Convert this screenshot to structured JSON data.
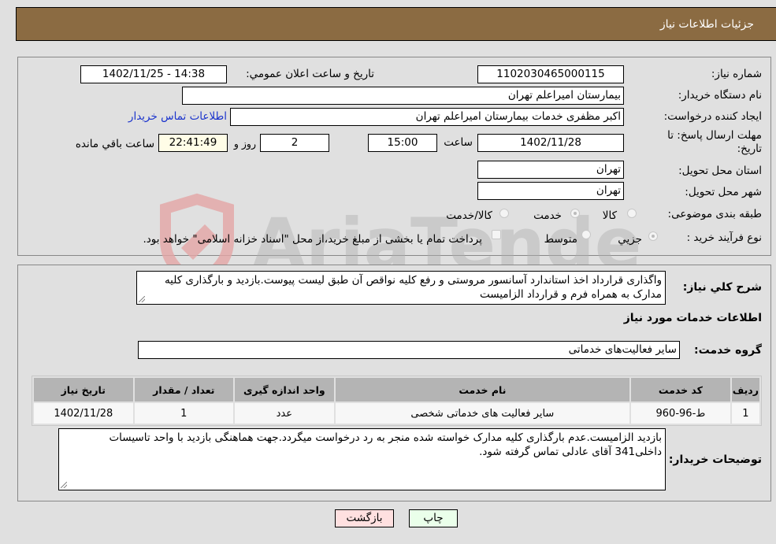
{
  "header": {
    "title": "جزئیات اطلاعات نیاز"
  },
  "fields": {
    "need_number": {
      "label": "شماره نیاز:",
      "value": "1102030465000115"
    },
    "announce_datetime": {
      "label": "تاریخ و ساعت اعلان عمومي:",
      "value": "1402/11/25 - 14:38"
    },
    "buyer_org": {
      "label": "نام دستگاه خریدار:",
      "value": "بیمارستان امیراعلم تهران"
    },
    "requester": {
      "label": "ایجاد کننده درخواست:",
      "value": "اکبر مظفری خدمات بیمارستان امیراعلم تهران"
    },
    "buyer_contact_link": "اطلاعات تماس خریدار",
    "deadline": {
      "label_line1": "مهلت ارسال پاسخ: تا",
      "label_line2": "تاریخ:",
      "date": "1402/11/28",
      "time_label": "ساعت",
      "time": "15:00",
      "days": "2",
      "days_label": "روز و",
      "remaining": "22:41:49",
      "remaining_label": "ساعت باقي مانده"
    },
    "province": {
      "label": "استان محل تحویل:",
      "value": "تهران"
    },
    "city": {
      "label": "شهر محل تحویل:",
      "value": "تهران"
    },
    "category": {
      "label": "طبقه بندی موضوعی:",
      "options": [
        "کالا",
        "خدمت",
        "کالا/خدمت"
      ],
      "selected": "خدمت"
    },
    "purchase_type": {
      "label": "نوع فرآیند خرید :",
      "options": [
        "جزيي",
        "متوسط"
      ],
      "selected": "جزيي",
      "treasury_note": "پرداخت تمام یا بخشی از مبلغ خرید،از محل \"اسناد خزانه اسلامی\" خواهد بود."
    }
  },
  "description": {
    "label": "شرح کلي نیاز:",
    "value": "واگذاری قرارداد اخذ استاندارد آسانسور مروستی و رفع کلیه نواقص آن طبق لیست پیوست.بازدید و بارگذاری کلیه مدارک به همراه فرم و قرارداد الزامیست"
  },
  "services_section": {
    "title": "اطلاعات خدمات مورد نیاز",
    "group_label": "گروه خدمت:",
    "group_value": "سایر فعالیت‌های خدماتی"
  },
  "table": {
    "columns": [
      "ردیف",
      "کد خدمت",
      "نام خدمت",
      "واحد اندازه گیری",
      "تعداد / مقدار",
      "تاریخ نیاز"
    ],
    "rows": [
      [
        "1",
        "ط-96-960",
        "سایر فعالیت های خدماتی شخصی",
        "عدد",
        "1",
        "1402/11/28"
      ]
    ]
  },
  "buyer_notes": {
    "label": "توضیحات خریدار:",
    "value": "بازدید الزامیست.عدم بارگذاری کلیه مدارک خواسته شده منجر به رد درخواست میگردد.جهت هماهنگی بازدید با واحد تاسیسات داخلی341 آقای عادلی تماس گرفته شود."
  },
  "buttons": {
    "print": "چاپ",
    "back": "بازگشت"
  },
  "watermark": "AriaTender.neT",
  "colors": {
    "header": "#8b6b42",
    "print_bg": "#eaffea",
    "back_bg": "#ffe0e0",
    "link": "#1a33cc"
  }
}
